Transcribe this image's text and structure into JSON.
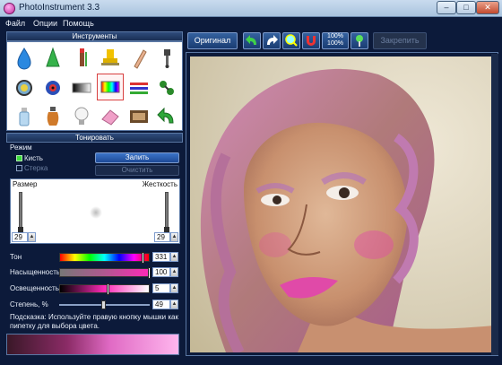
{
  "window": {
    "title": "PhotoInstrument 3.3",
    "min": "–",
    "max": "□",
    "close": "✕"
  },
  "menu": [
    "Файл",
    "Опции",
    "Помощь"
  ],
  "tools_panel": {
    "title": "Инструменты",
    "tools": [
      "drop-icon",
      "cone-icon",
      "marker-icon",
      "stamp-icon",
      "brush-icon",
      "pin-icon",
      "lens-icon",
      "eye-icon",
      "gradient-icon",
      "rainbow-icon",
      "stripes-icon",
      "clone-icon",
      "bottle-icon",
      "vase-icon",
      "bulb-icon",
      "eraser-icon",
      "film-icon",
      "undo-arrow-icon"
    ],
    "selected_index": 9
  },
  "toning": {
    "title": "Тонировать",
    "mode_label": "Режим",
    "brush_label": "Кисть",
    "brush_checked": true,
    "eraser_label": "Стерка",
    "eraser_checked": false,
    "fill_button": "Залить",
    "clear_button": "Очистить",
    "size_label": "Размер",
    "size_value": "29",
    "hardness_label": "Жесткость",
    "hardness_value": "29",
    "hue_label": "Тон",
    "hue_value": "331",
    "saturation_label": "Насыщенность",
    "saturation_value": "100",
    "lightness_label": "Освещенность",
    "lightness_value": "5",
    "degree_label": "Степень, %",
    "degree_value": "49",
    "hint": "Подсказка: Используйте правую кнопку мышки как пипетку для выбора цвета."
  },
  "toolbar": {
    "original_button": "Оригинал",
    "zoom_label_top": "100%",
    "zoom_label_bottom": "100%",
    "lock_button": "Закрепить"
  },
  "colors": {
    "accent": "#1d4a97",
    "background": "#0c1a3a",
    "toning": "#e04aa8"
  }
}
